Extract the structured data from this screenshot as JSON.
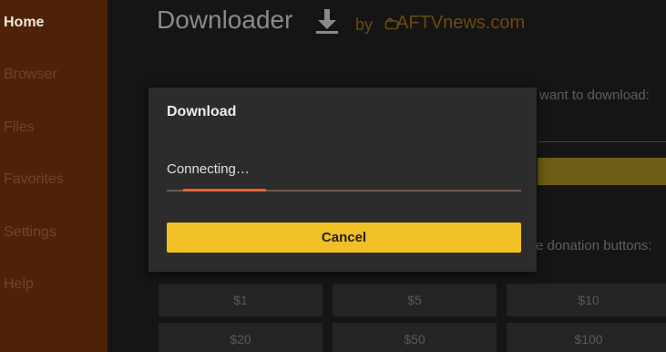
{
  "sidebar": {
    "items": [
      {
        "label": "Home"
      },
      {
        "label": "Browser"
      },
      {
        "label": "Files"
      },
      {
        "label": "Favorites"
      },
      {
        "label": "Settings"
      },
      {
        "label": "Help"
      }
    ],
    "active_color": "#f0e6de",
    "background": "#4f2208"
  },
  "header": {
    "title": "Downloader",
    "by": "by",
    "brand": "AFTVnews.com",
    "download_icon": "download-arrow-icon",
    "brand_icon": "tv-logo-icon"
  },
  "background_page": {
    "prompt_fragment": "want to download:",
    "donation_fragment": "e donation buttons:",
    "donations": [
      {
        "label": "$1"
      },
      {
        "label": "$5"
      },
      {
        "label": "$10"
      },
      {
        "label": "$20"
      },
      {
        "label": "$50"
      },
      {
        "label": "$100"
      }
    ]
  },
  "dialog": {
    "title": "Download",
    "status": "Connecting…",
    "progress": 0.28,
    "cancel_label": "Cancel",
    "accent": "#f0c024",
    "progress_color": "#e8612c"
  }
}
